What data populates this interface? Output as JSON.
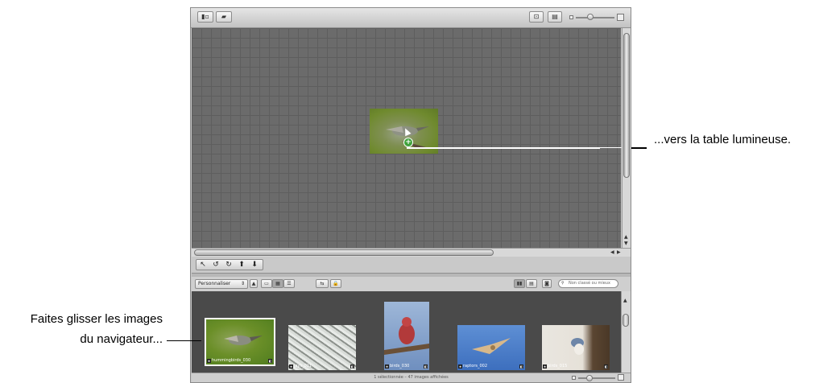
{
  "callouts": {
    "right": "...vers la table lumineuse.",
    "left_line1": "Faites glisser les images",
    "left_line2": "du navigateur..."
  },
  "browser_toolbar": {
    "sort_select": "Personnaliser",
    "search_placeholder": "Non classé ou mieux"
  },
  "thumbnails": [
    {
      "label": "hummingbirds_030",
      "selected": true
    },
    {
      "label": "jays_001"
    },
    {
      "label": "birds_030"
    },
    {
      "label": "raptors_002"
    },
    {
      "label": "birds_015"
    }
  ],
  "status": "1 sélectionnée – 47 images affichées",
  "icons": {
    "star": "★",
    "badge": "◧",
    "drag_add": "+"
  },
  "colors": {
    "lighttable": "#6b6b6b",
    "browser_bg": "#4a4a4a",
    "add_badge": "#3fa23a"
  }
}
